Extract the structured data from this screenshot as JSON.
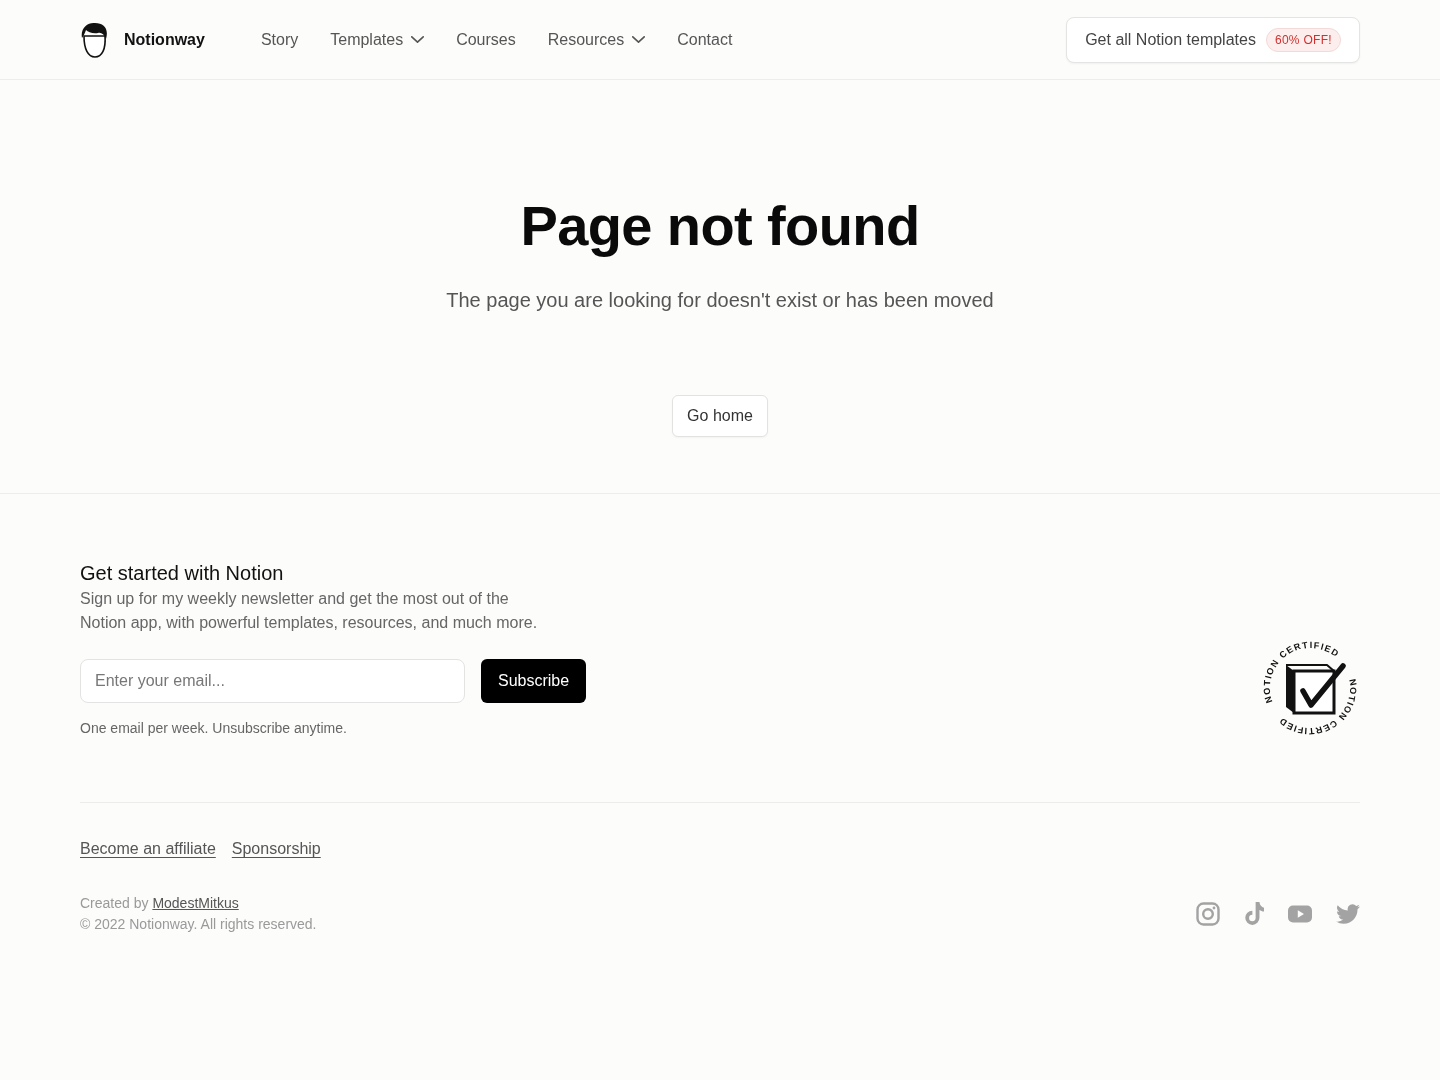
{
  "header": {
    "brand": "Notionway",
    "nav": [
      {
        "label": "Story",
        "has_menu": false
      },
      {
        "label": "Templates",
        "has_menu": true
      },
      {
        "label": "Courses",
        "has_menu": false
      },
      {
        "label": "Resources",
        "has_menu": true
      },
      {
        "label": "Contact",
        "has_menu": false
      }
    ],
    "cta": {
      "label": "Get all Notion templates",
      "badge": "60% OFF!"
    }
  },
  "main": {
    "title": "Page not found",
    "subtitle": "The page you are looking for doesn't exist or has been moved",
    "button": "Go home"
  },
  "newsletter": {
    "title": "Get started with Notion",
    "text": "Sign up for my weekly newsletter and get the most out of the Notion app, with powerful templates, resources, and much more.",
    "email_field": {
      "placeholder": "Enter your email..."
    },
    "button": "Subscribe",
    "note": "One email per week. Unsubscribe anytime.",
    "seal": {
      "ring_text": [
        "NOTION CERTIFIED",
        "NOTION CERTIFIED"
      ]
    }
  },
  "footer": {
    "links": [
      "Become an affiliate",
      "Sponsorship"
    ],
    "credit": {
      "text": "Created by",
      "link": "ModestMitkus"
    },
    "copyright": "© 2022 Notionway. All rights reserved."
  }
}
